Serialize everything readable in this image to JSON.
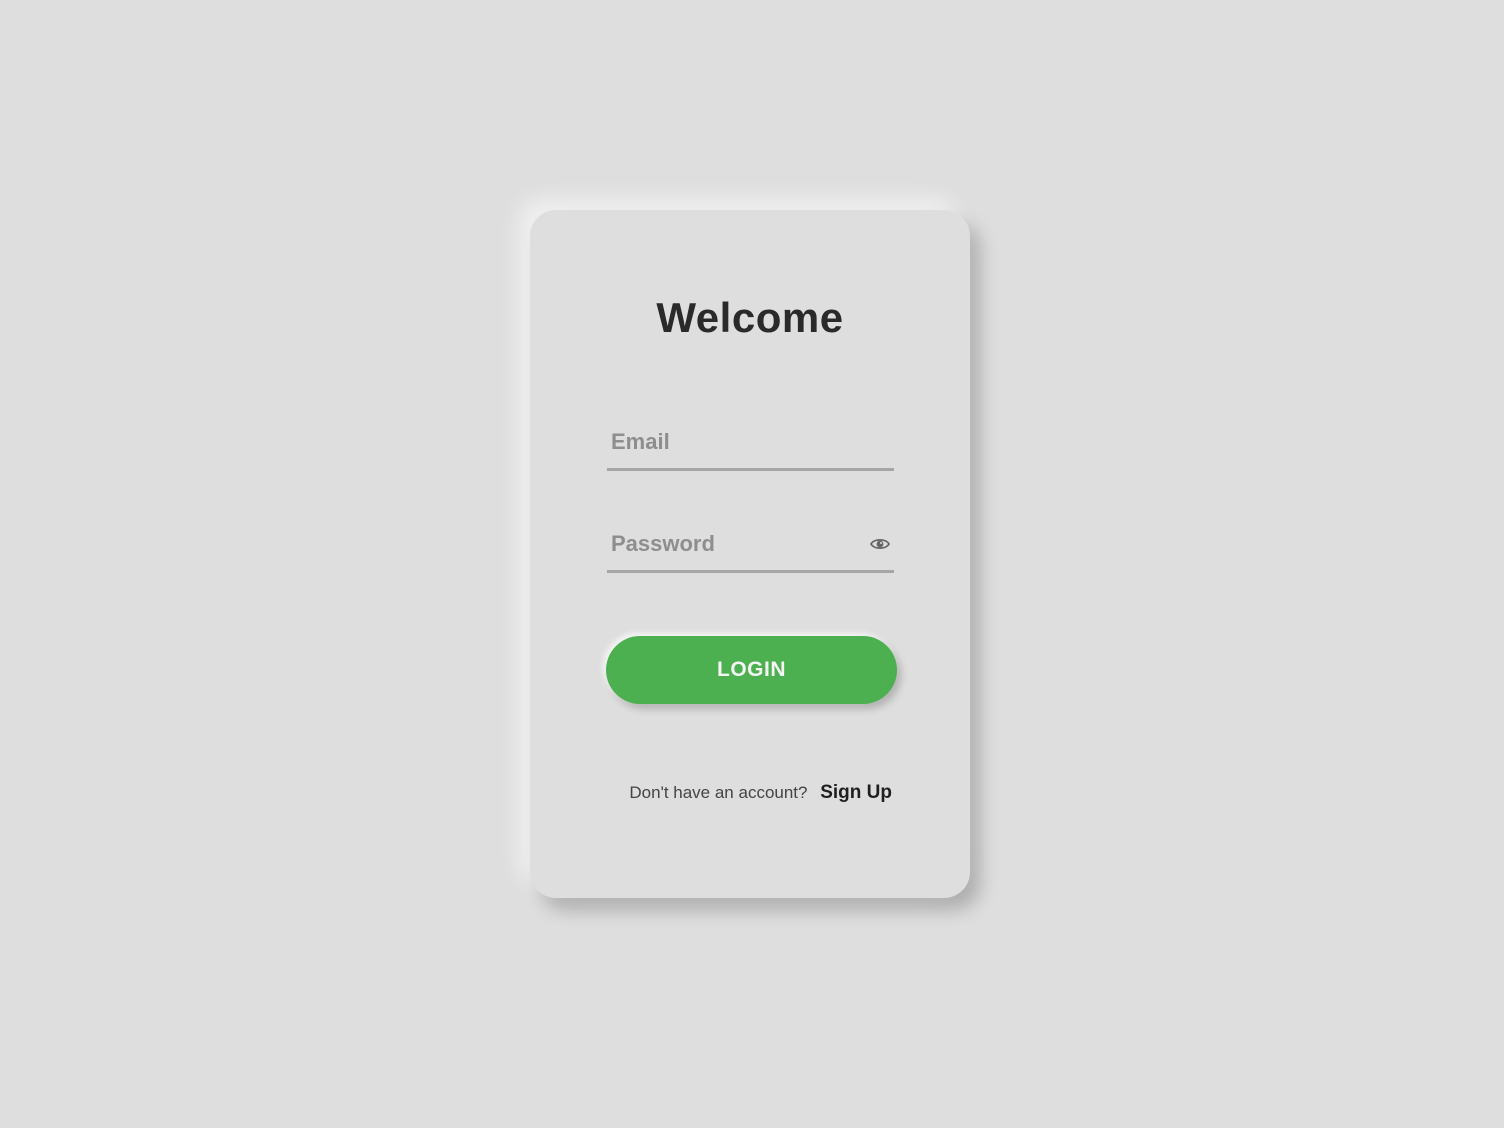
{
  "login_card": {
    "title": "Welcome",
    "email_field": {
      "placeholder": "Email",
      "value": ""
    },
    "password_field": {
      "placeholder": "Password",
      "value": "",
      "toggle_icon": "eye-icon"
    },
    "login_button": {
      "label": "LOGIN",
      "color": "#4caf50"
    },
    "signup": {
      "prompt": "Don't have an account?",
      "link_label": "Sign Up"
    }
  },
  "colors": {
    "background": "#dedede",
    "title_text": "#2a2a2a",
    "accent": "#4caf50"
  }
}
